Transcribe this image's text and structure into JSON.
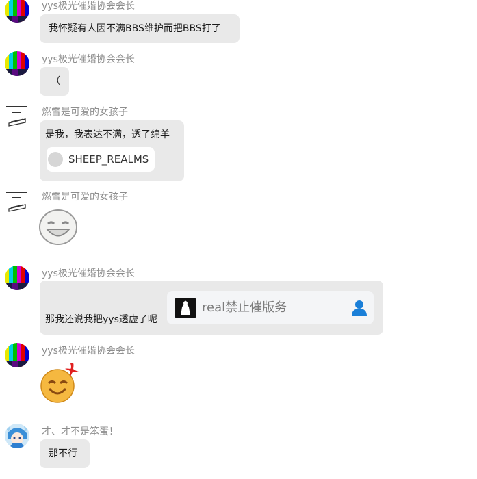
{
  "messages": [
    {
      "sender": "yys极光催婚协会会长",
      "text": "我怀疑有人因不满BBS维护而把BBS打了"
    },
    {
      "sender": "yys极光催婚协会会长",
      "text": "（"
    },
    {
      "sender": "燃雪是可爱的女孩子",
      "text": "是我，我表达不满，透了绵羊",
      "mention": "SHEEP_REALMS"
    },
    {
      "sender": "燃雪是可爱的女孩子",
      "sticker": "smiling-face-sticker"
    },
    {
      "sender": "yys极光催婚协会会长",
      "text": "那我还说我把yys透虚了呢",
      "card_name": "real禁止催版务"
    },
    {
      "sender": "yys极光催婚协会会长",
      "sticker": "angry-smiley-sticker"
    },
    {
      "sender": "才、才不是笨蛋！",
      "text": "那不行"
    }
  ],
  "colors": {
    "bubble": "#e9e9e9",
    "sender": "#8e8e8e",
    "card_bg": "#f4f5f7",
    "profile_icon": "#1a7fd8"
  }
}
